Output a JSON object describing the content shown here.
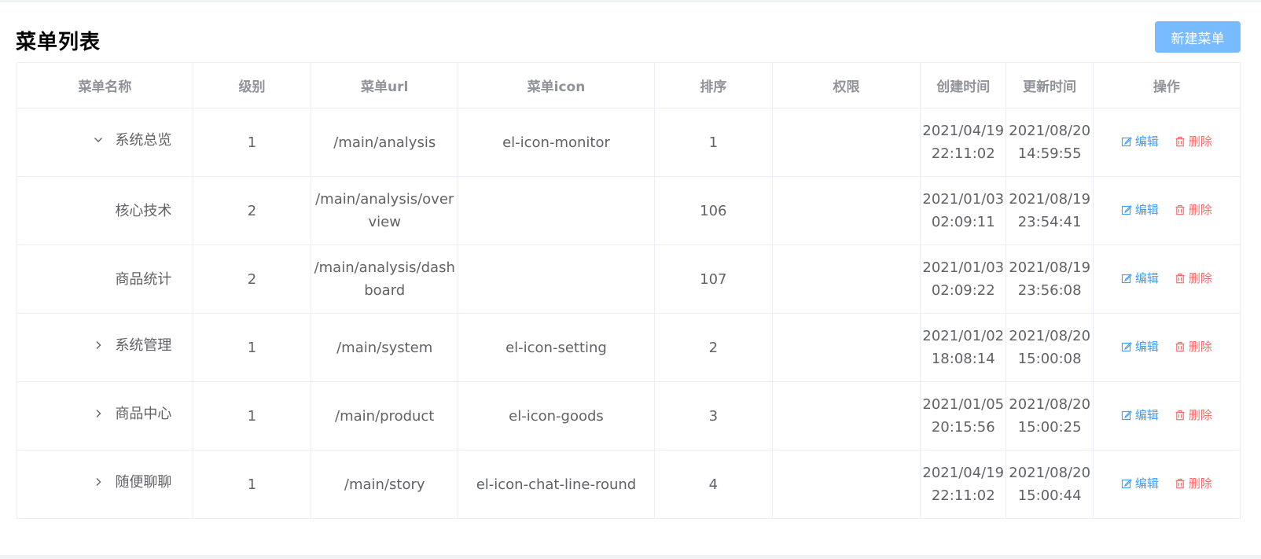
{
  "header": {
    "title": "菜单列表",
    "new_button_label": "新建菜单"
  },
  "table": {
    "columns": [
      "菜单名称",
      "级别",
      "菜单url",
      "菜单icon",
      "排序",
      "权限",
      "创建时间",
      "更新时间",
      "操作"
    ],
    "rows": [
      {
        "name": "系统总览",
        "level": "1",
        "url": "/main/analysis",
        "icon": "el-icon-monitor",
        "sort": "1",
        "permission": "",
        "created_date": "2021/04/19",
        "created_time": "22:11:02",
        "updated_date": "2021/08/20",
        "updated_time": "14:59:55",
        "expander": "chevron-down-icon"
      },
      {
        "name": "核心技术",
        "level": "2",
        "url": "/main/analysis/overview",
        "icon": "",
        "sort": "106",
        "permission": "",
        "created_date": "2021/01/03",
        "created_time": "02:09:11",
        "updated_date": "2021/08/19",
        "updated_time": "23:54:41",
        "expander": ""
      },
      {
        "name": "商品统计",
        "level": "2",
        "url": "/main/analysis/dashboard",
        "icon": "",
        "sort": "107",
        "permission": "",
        "created_date": "2021/01/03",
        "created_time": "02:09:22",
        "updated_date": "2021/08/19",
        "updated_time": "23:56:08",
        "expander": ""
      },
      {
        "name": "系统管理",
        "level": "1",
        "url": "/main/system",
        "icon": "el-icon-setting",
        "sort": "2",
        "permission": "",
        "created_date": "2021/01/02",
        "created_time": "18:08:14",
        "updated_date": "2021/08/20",
        "updated_time": "15:00:08",
        "expander": "chevron-right-icon"
      },
      {
        "name": "商品中心",
        "level": "1",
        "url": "/main/product",
        "icon": "el-icon-goods",
        "sort": "3",
        "permission": "",
        "created_date": "2021/01/05",
        "created_time": "20:15:56",
        "updated_date": "2021/08/20",
        "updated_time": "15:00:25",
        "expander": "chevron-right-icon"
      },
      {
        "name": "随便聊聊",
        "level": "1",
        "url": "/main/story",
        "icon": "el-icon-chat-line-round",
        "sort": "4",
        "permission": "",
        "created_date": "2021/04/19",
        "created_time": "22:11:02",
        "updated_date": "2021/08/20",
        "updated_time": "15:00:44",
        "expander": "chevron-right-icon"
      }
    ],
    "actions": {
      "edit_label": "编辑",
      "edit_icon": "edit-icon",
      "delete_label": "删除",
      "delete_icon": "trash-icon"
    }
  },
  "colors": {
    "primary": "#409eff",
    "primary_light": "#79bbff",
    "danger": "#f56c6c",
    "header_text": "#909399",
    "cell_text": "#606266",
    "border": "#ebeef5"
  }
}
